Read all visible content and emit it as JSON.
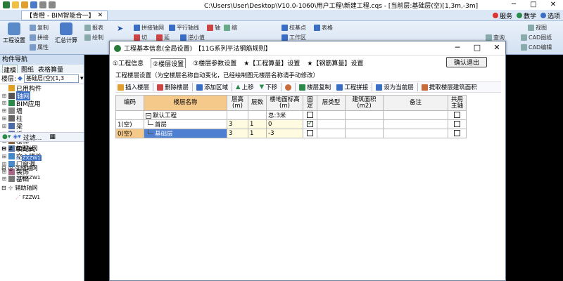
{
  "window": {
    "title": "C:\\Users\\User\\Desktop\\V10.0-1060\\用户工程\\新建工程.cqs - [当前层:基础层(空)[1,3m,-3m]",
    "project_tab": "【青橙 - BIM智能合一】"
  },
  "menu_right": {
    "service": "服务",
    "teaching": "教学",
    "options": "选项"
  },
  "ribbon": {
    "project_settings": "工程设置",
    "copy": "复制",
    "stitch": "拼接",
    "attr": "属性",
    "summary_calc": "汇总计算",
    "report": "报表",
    "draw": "绘制",
    "stitch_axis": "拼接轴网",
    "parallel_axis": "平行轴线",
    "axis": "轴",
    "zoom": "缩",
    "cut": "切",
    "extend": "延",
    "anticlockwise": "逆小值",
    "value_3000": "3000",
    "correct_point": "校基点",
    "table": "表格",
    "work_zone": "工作区",
    "check_view": "检查",
    "cad_drawing": "CAD图纸",
    "cad_edit": "CAD编辑",
    "measure": "测量",
    "query": "查询",
    "annotate": "标注",
    "find": "查找",
    "view": "视图"
  },
  "leftnav": {
    "header": "构件导航",
    "tabs": [
      "建模",
      "图纸",
      "表格算量"
    ],
    "floor_label": "楼层:",
    "floor_value": "基础层(空)[1,3",
    "items": [
      {
        "label": "已用构件",
        "exp": "",
        "icon": "used-icon",
        "color": "#e0a020"
      },
      {
        "label": "轴网",
        "exp": "⊞",
        "icon": "axis-grid-icon",
        "color": "#555",
        "selected": true
      },
      {
        "label": "BIM应用",
        "exp": "⊞",
        "icon": "bim-icon",
        "color": "#2a8a4a"
      },
      {
        "label": "墙",
        "exp": "⊞",
        "icon": "wall-icon",
        "color": "#888"
      },
      {
        "label": "柱",
        "exp": "⊞",
        "icon": "column-icon",
        "color": "#666"
      },
      {
        "label": "梁",
        "exp": "⊞",
        "icon": "beam-icon",
        "color": "#4a6aa8"
      },
      {
        "label": "板",
        "exp": "⊞",
        "icon": "slab-icon",
        "color": "#6a7ab8"
      },
      {
        "label": "楼梯",
        "exp": "⊞",
        "icon": "stair-icon",
        "color": "#886644"
      },
      {
        "label": "装配式",
        "exp": "⊞",
        "icon": "prefab-icon",
        "color": "#5577aa"
      },
      {
        "label": "空心楼盖",
        "exp": "⊞",
        "icon": "hollow-slab-icon",
        "color": "#4488cc"
      },
      {
        "label": "门窗洞",
        "exp": "⊞",
        "icon": "door-window-icon",
        "color": "#4a8ac8"
      },
      {
        "label": "装饰",
        "exp": "⊞",
        "icon": "decoration-icon",
        "color": "#aa6688"
      },
      {
        "label": "基础",
        "exp": "⊞",
        "icon": "foundation-icon",
        "color": "#777"
      }
    ],
    "filter_label": "过滤...",
    "axis_tree": [
      {
        "label": "直线轴网",
        "child": "ZXZW1"
      },
      {
        "label": "弧线轴网",
        "child": "HXZW1"
      },
      {
        "label": "辅助轴网",
        "child": "FZZW1"
      }
    ]
  },
  "dialog": {
    "title": "工程基本信息(全局设置)",
    "subtitle": "【11G系列平法钢筋规则】",
    "tabs": [
      "①工程信息",
      "②楼层设置",
      "③楼层参数设置",
      "★【工程算量】设置",
      "★【钢筋算量】设置"
    ],
    "active_tab": 1,
    "confirm": "确认退出",
    "section_title": "工程楼层设置（为空楼层名称自动变化，已经绘制图元楼层名称请手动修改）",
    "toolbar": {
      "insert": "插入楼层",
      "delete": "删除楼层",
      "add_zone": "添加区域",
      "move_up": "上移",
      "move_down": "下移",
      "copy_floor": "楼层复制",
      "project_stitch": "工程拼接",
      "set_current": "设为当前层",
      "extract_area": "提取楼层建筑面积"
    },
    "columns": {
      "code": "编码",
      "name": "楼层名称",
      "height": "层高(m)",
      "count": "层数",
      "elevation": "楼地面标高(m)",
      "fixed": "固定",
      "type": "层类型",
      "area": "建筑面积(m2)",
      "remark": "备注",
      "shared_main": "共用主轴"
    },
    "rows": [
      {
        "code": "",
        "name": "默认工程",
        "height": "",
        "count": "",
        "elevation": "总:3米",
        "fixed": false,
        "shared": false,
        "tree": "root"
      },
      {
        "code": "1(空)",
        "name": "首层",
        "height": "3",
        "count": "1",
        "elevation": "0",
        "fixed": true,
        "shared": false,
        "tree": "child"
      },
      {
        "code": "0(空)",
        "name": "基础层",
        "height": "3",
        "count": "1",
        "elevation": "-3",
        "fixed": false,
        "shared": false,
        "tree": "child",
        "selected": true
      }
    ]
  }
}
